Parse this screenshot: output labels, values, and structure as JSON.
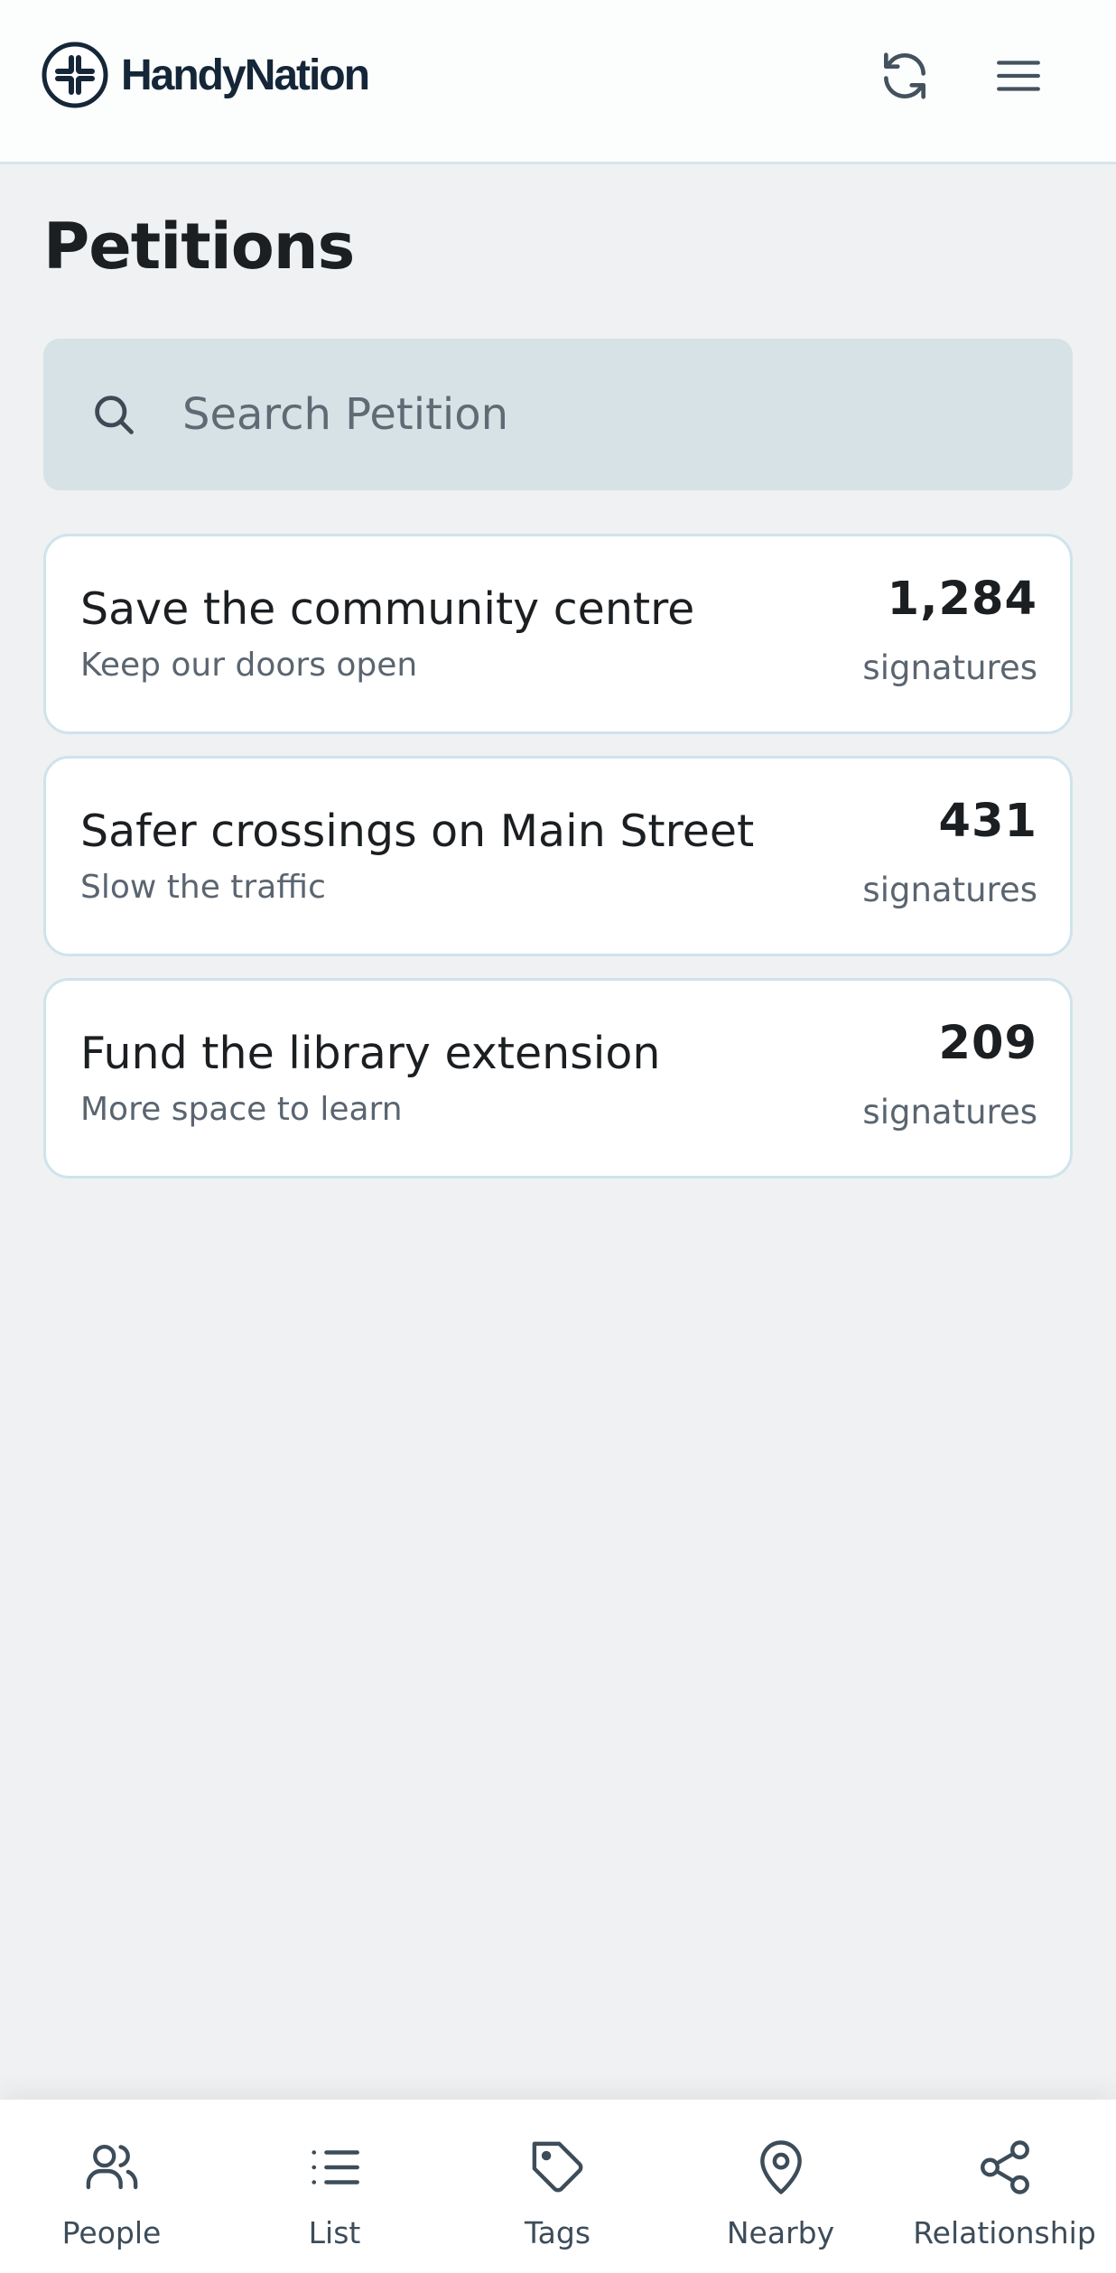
{
  "header": {
    "brand": "HandyNation",
    "icons": {
      "logo": "handynation-logo-icon",
      "refresh": "refresh-icon",
      "menu": "hamburger-menu-icon"
    }
  },
  "page": {
    "title": "Petitions"
  },
  "search": {
    "placeholder": "Search Petition",
    "value": "",
    "icon": "search-icon"
  },
  "petitions": [
    {
      "title": "Save the community centre",
      "subtitle": "Keep our doors open",
      "count": "1,284",
      "unit": "signatures"
    },
    {
      "title": "Safer crossings on Main Street",
      "subtitle": "Slow the traffic",
      "count": "431",
      "unit": "signatures"
    },
    {
      "title": "Fund the library extension",
      "subtitle": "More space to learn",
      "count": "209",
      "unit": "signatures"
    }
  ],
  "bottom_nav": {
    "items": [
      {
        "label": "People",
        "icon": "people-icon"
      },
      {
        "label": "List",
        "icon": "list-icon"
      },
      {
        "label": "Tags",
        "icon": "tag-icon"
      },
      {
        "label": "Nearby",
        "icon": "map-pin-icon"
      },
      {
        "label": "Relationship",
        "icon": "share-nodes-icon"
      }
    ]
  },
  "colors": {
    "background": "#eff1f3",
    "header_bg": "#fcfdfd",
    "brand_text": "#152638",
    "search_bg": "#d7e2e7",
    "card_border": "#cfe3ec",
    "icon_gray": "#44525e"
  }
}
